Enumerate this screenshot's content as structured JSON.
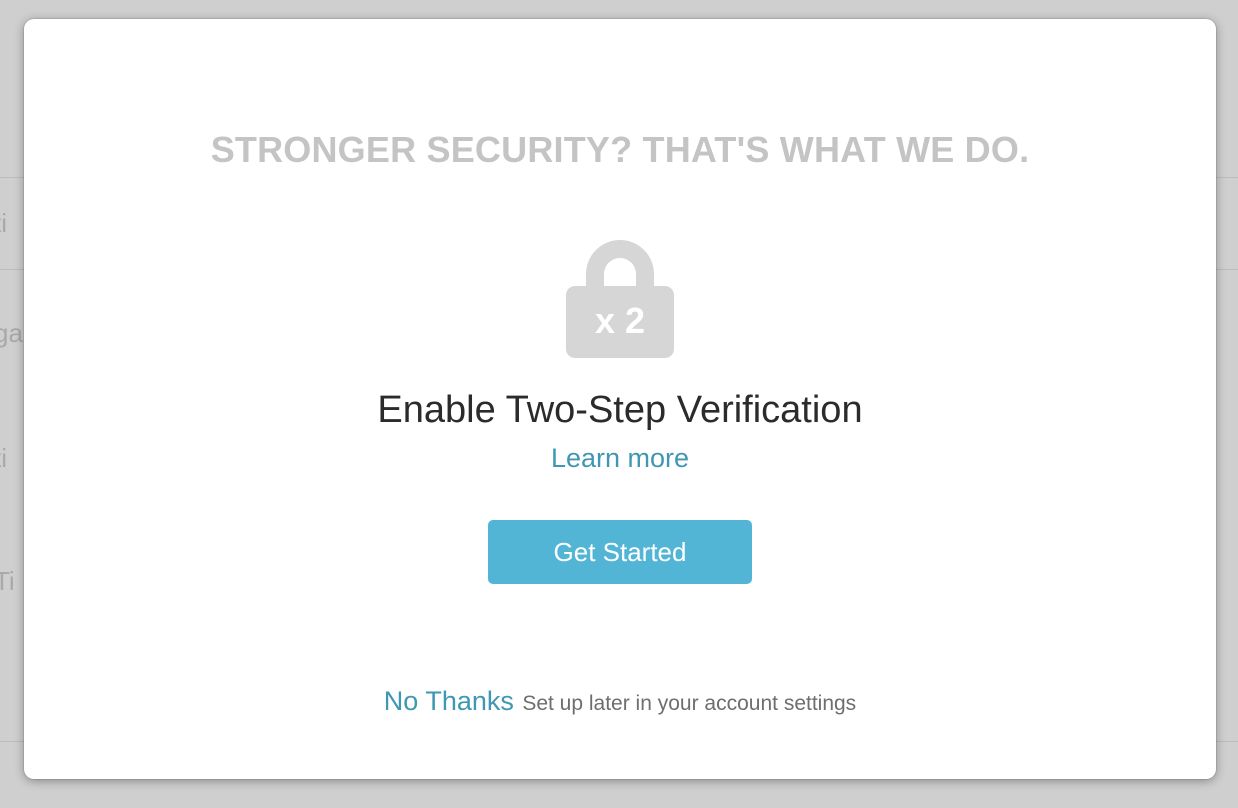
{
  "background": {
    "fragments": [
      "ti",
      "ga",
      "ti",
      "Ti"
    ]
  },
  "modal": {
    "heading": "STRONGER SECURITY? THAT'S WHAT WE DO.",
    "lock_icon": "padlock-icon",
    "lock_label": "x 2",
    "title": "Enable Two-Step Verification",
    "learn_more": "Learn more",
    "primary_button": "Get Started",
    "dismiss_link": "No Thanks",
    "dismiss_hint": "Set up later in your account settings"
  },
  "colors": {
    "accent": "#53b5d6",
    "link": "#3f97b3",
    "heading": "#c4c4c4",
    "lock": "#d6d6d6"
  }
}
